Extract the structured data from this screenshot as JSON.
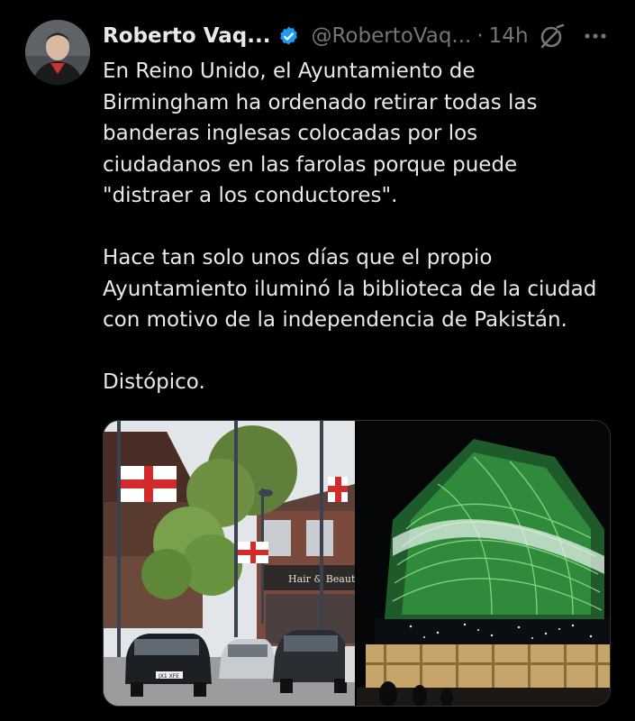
{
  "tweet": {
    "display_name": "Roberto Vaq...",
    "handle": "@RobertoVaq...",
    "separator": "·",
    "time": "14h",
    "text": "En Reino Unido, el Ayuntamiento de\nBirmingham ha ordenado retirar todas las\nbanderas inglesas colocadas por los\nciudadanos en las farolas porque puede\n\"distraer a los conductores\".\n\nHace tan solo unos días que el propio\nAyuntamiento iluminó la biblioteca de la ciudad\ncon motivo de la independencia de Pakistán.\n\nDistópico.",
    "verified_color": "#1d9bf0",
    "icons": {
      "verified": "verified-badge-icon",
      "grok": "grok-icon",
      "more": "more-options-icon"
    }
  },
  "media": {
    "left_photo": {
      "shop_sign": "Hair & Beauty",
      "plate": "JX1 XFE"
    },
    "right_photo": {}
  },
  "colors": {
    "background": "#000000",
    "text_primary": "#e7e9ea",
    "text_secondary": "#71767b",
    "border": "#2f3336"
  }
}
